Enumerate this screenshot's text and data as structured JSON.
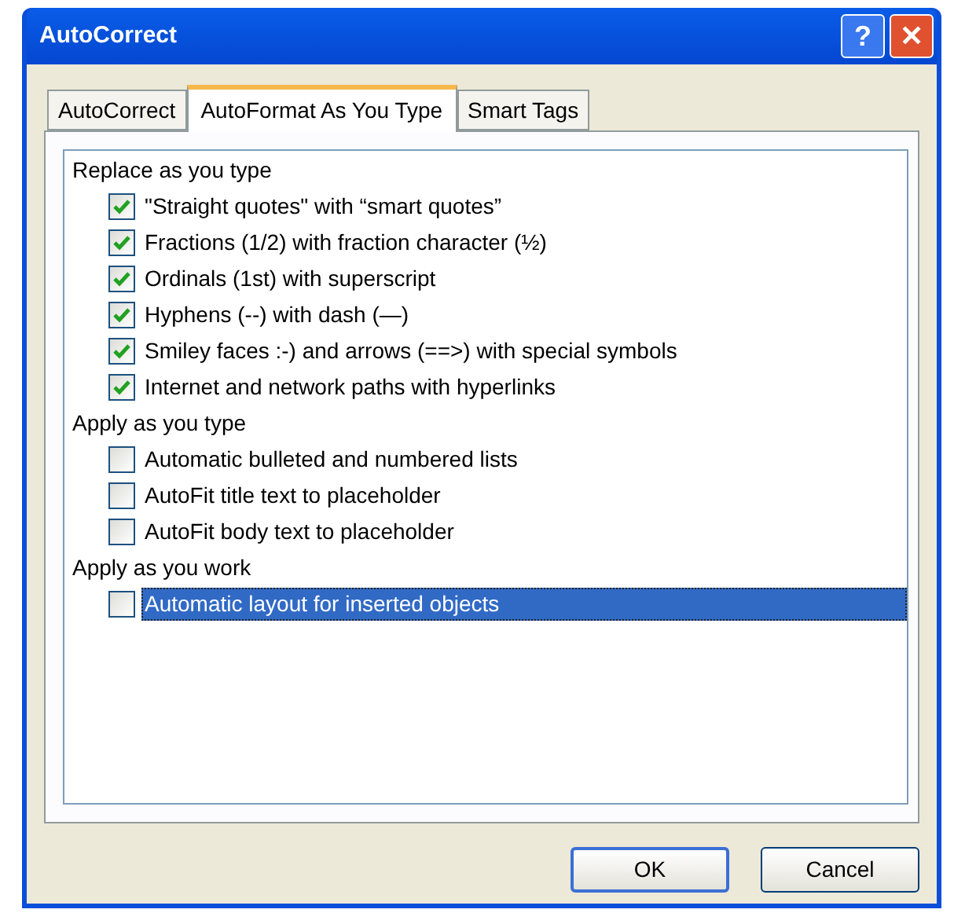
{
  "window": {
    "title": "AutoCorrect",
    "buttons": [
      {
        "kind": "help",
        "label": "?"
      },
      {
        "kind": "close",
        "label": "✕"
      }
    ]
  },
  "tabs": [
    {
      "label": "AutoCorrect",
      "selected": false
    },
    {
      "label": "AutoFormat As You Type",
      "selected": true
    },
    {
      "label": "Smart Tags",
      "selected": false
    }
  ],
  "groups": [
    {
      "heading": "Replace as you type",
      "options": [
        {
          "label": "\"Straight quotes\" with “smart quotes”",
          "checked": true,
          "selected": false
        },
        {
          "label": "Fractions (1/2) with fraction character (½)",
          "checked": true,
          "selected": false
        },
        {
          "label": "Ordinals (1st) with superscript",
          "checked": true,
          "selected": false
        },
        {
          "label": "Hyphens (--) with dash (—)",
          "checked": true,
          "selected": false
        },
        {
          "label": "Smiley faces :-) and arrows (==>) with special symbols",
          "checked": true,
          "selected": false
        },
        {
          "label": "Internet and network paths with hyperlinks",
          "checked": true,
          "selected": false
        }
      ]
    },
    {
      "heading": "Apply as you type",
      "options": [
        {
          "label": "Automatic bulleted and numbered lists",
          "checked": false,
          "selected": false
        },
        {
          "label": "AutoFit title text to placeholder",
          "checked": false,
          "selected": false
        },
        {
          "label": "AutoFit body text to placeholder",
          "checked": false,
          "selected": false
        }
      ]
    },
    {
      "heading": "Apply as you work",
      "options": [
        {
          "label": "Automatic layout for inserted objects",
          "checked": false,
          "selected": true
        }
      ]
    }
  ],
  "buttons": [
    {
      "label": "OK",
      "default": true
    },
    {
      "label": "Cancel",
      "default": false
    }
  ]
}
